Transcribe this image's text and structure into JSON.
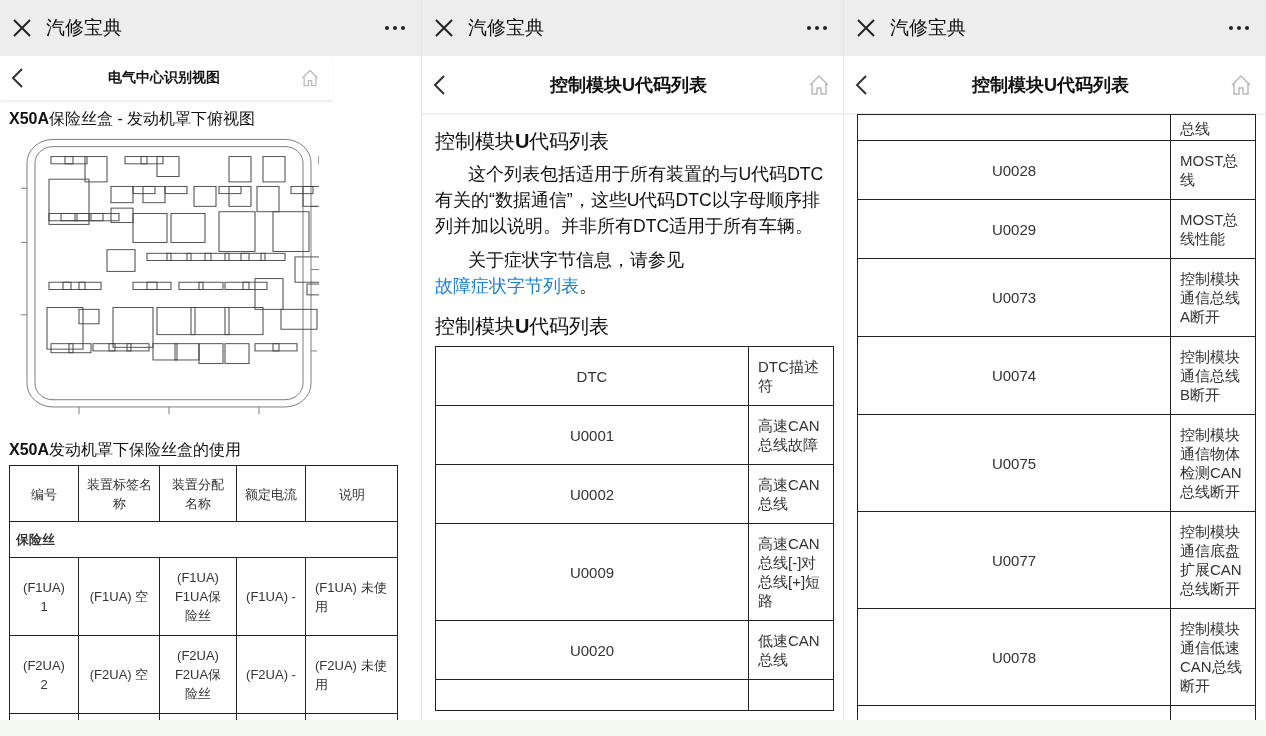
{
  "panels": [
    {
      "kind": "fuse",
      "app_title": "汽修宝典",
      "page_title": "电气中心识别视图",
      "heading": "**X50A**保险丝盒 - 发动机罩下俯视图",
      "subheading": "**X50A**发动机罩下保险丝盒的使用",
      "table": {
        "columns": [
          "编号",
          "装置标签名称",
          "装置分配名称",
          "额定电流",
          "说明"
        ],
        "section": "保险丝",
        "more_rows_below": true,
        "rows": [
          [
            "(F1UA) 1",
            "(F1UA) 空",
            "(F1UA) F1UA保险丝",
            "(F1UA) -",
            "(F1UA) 未使用"
          ],
          [
            "(F2UA) 2",
            "(F2UA) 空",
            "(F2UA) F2UA保险丝",
            "(F2UA) -",
            "(F2UA) 未使用"
          ]
        ]
      }
    },
    {
      "kind": "dtc",
      "app_title": "汽修宝典",
      "page_title": "控制模块U代码列表",
      "heading": "控制模块**U**代码列表",
      "paragraphs": [
        {
          "text": "这个列表包括适用于所有装置的与U代码DTC有关的“数据通信”，这些U代码DTC以字母顺序排列并加以说明。并非所有DTC适用于所有车辆。"
        },
        {
          "text": "关于症状字节信息，请参见",
          "link": "故障症状字节列表",
          "after": "。"
        }
      ],
      "table_title": "控制模块**U**代码列表",
      "table": {
        "columns": [
          "DTC",
          "DTC描述符"
        ],
        "more_rows_below": true,
        "rows": [
          {
            "code": "U0001",
            "description": "高速CAN总线故障"
          },
          {
            "code": "U0002",
            "description": "高速CAN总线"
          },
          {
            "code": "U0009",
            "description": "高速CAN总线[-]对总线[+]短路"
          },
          {
            "code": "U0020",
            "description": "低速CAN总线"
          }
        ]
      }
    },
    {
      "kind": "dtc",
      "app_title": "汽修宝典",
      "page_title": "控制模块U代码列表",
      "table": {
        "more_rows_below": true,
        "rows": [
          {
            "description": "总线"
          },
          {
            "code": "U0028",
            "description": "MOST总线"
          },
          {
            "code": "U0029",
            "description": "MOST总线性能"
          },
          {
            "code": "U0073",
            "description": "控制模块通信总线A断开"
          },
          {
            "code": "U0074",
            "description": "控制模块通信总线B断开"
          },
          {
            "code": "U0075",
            "description": "控制模块通信物体检测CAN总线断开"
          },
          {
            "code": "U0077",
            "description": "控制模块通信底盘扩展CAN总线断开"
          },
          {
            "code": "U0078",
            "description": "控制模块通信低速CAN总线断开"
          }
        ]
      }
    }
  ]
}
